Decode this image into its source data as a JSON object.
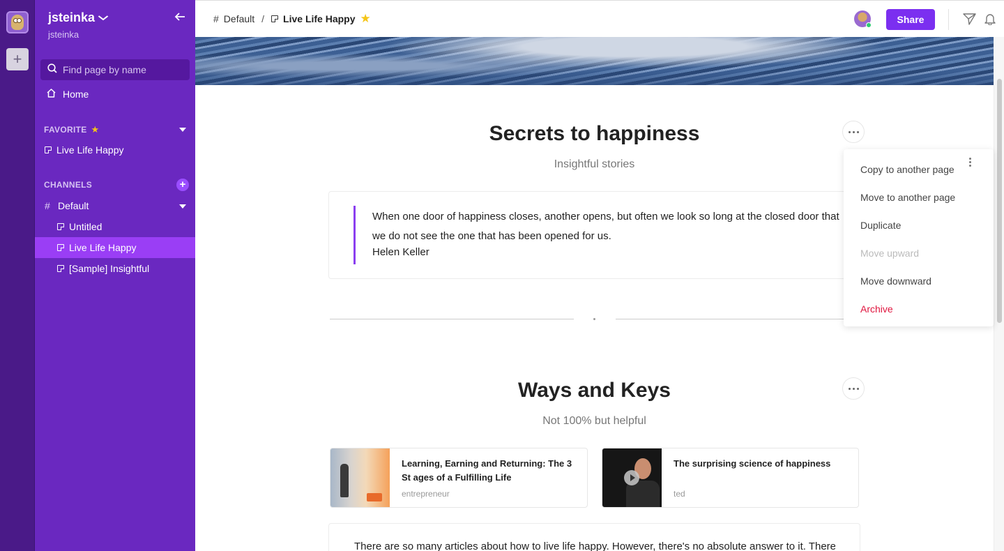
{
  "workspace": {
    "name": "jsteinka",
    "username": "jsteinka",
    "add_label": "+"
  },
  "sidebar": {
    "search_placeholder": "Find page by name",
    "home_label": "Home",
    "favorite_label": "FAVORITE",
    "favorites": [
      {
        "label": "Live Life Happy"
      }
    ],
    "channels_label": "CHANNELS",
    "channel": {
      "label": "Default"
    },
    "pages": [
      {
        "label": "Untitled",
        "active": false
      },
      {
        "label": "Live Life Happy",
        "active": true
      },
      {
        "label": "[Sample] Insightful",
        "active": false
      }
    ]
  },
  "topbar": {
    "breadcrumb_channel": "Default",
    "breadcrumb_sep": "/",
    "breadcrumb_page": "Live Life Happy",
    "share_label": "Share"
  },
  "content": {
    "section1": {
      "title": "Secrets to happiness",
      "subtitle": "Insightful stories",
      "quote_text": "When one door of happiness closes, another opens, but often we look so long at the closed door that we do not see the one that has been opened for us.",
      "quote_author": "Helen Keller"
    },
    "section2": {
      "title": "Ways and Keys",
      "subtitle": "Not 100% but helpful",
      "cards": [
        {
          "title": "Learning, Earning and Returning: The 3 St ages of a Fulfilling Life",
          "source": "entrepreneur"
        },
        {
          "title": "The surprising science of happiness",
          "source": "ted"
        }
      ],
      "text": "There are so many articles about how to live life happy. However, there's no absolute answer to it. There"
    }
  },
  "menu": {
    "items": [
      {
        "label": "Copy to another page",
        "state": "normal"
      },
      {
        "label": "Move to another page",
        "state": "normal"
      },
      {
        "label": "Duplicate",
        "state": "normal"
      },
      {
        "label": "Move upward",
        "state": "disabled"
      },
      {
        "label": "Move downward",
        "state": "normal"
      },
      {
        "label": "Archive",
        "state": "danger"
      }
    ]
  },
  "colors": {
    "sidebar": "#6a28c0",
    "rail": "#4a1a88",
    "accent": "#7b2ff0",
    "active_item": "#9a3ef5",
    "danger": "#e0163f",
    "favorite_star": "#f5c518"
  }
}
